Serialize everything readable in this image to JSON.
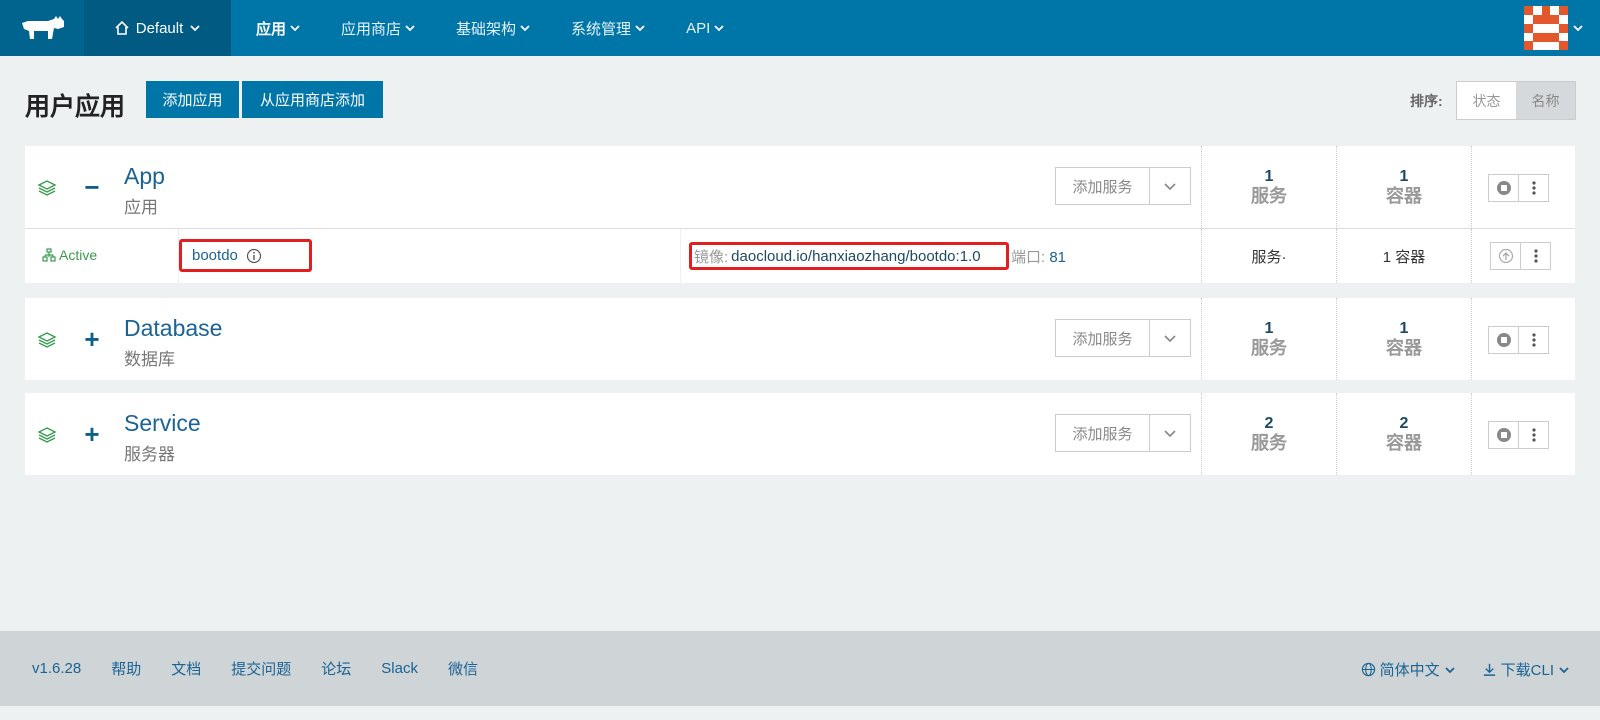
{
  "nav": {
    "environment": "Default",
    "items": [
      {
        "label": "应用",
        "active": true
      },
      {
        "label": "应用商店",
        "active": false
      },
      {
        "label": "基础架构",
        "active": false
      },
      {
        "label": "系统管理",
        "active": false
      },
      {
        "label": "API",
        "active": false
      }
    ]
  },
  "page": {
    "title": "用户应用",
    "add_app_label": "添加应用",
    "add_from_catalog_label": "从应用商店添加",
    "sort_label": "排序:",
    "sort_options": [
      "状态",
      "名称"
    ],
    "sort_selected": "名称"
  },
  "stacks": [
    {
      "name": "App",
      "description": "应用",
      "expanded": true,
      "toggle": "−",
      "add_service_label": "添加服务",
      "service_count": "1",
      "service_label": "服务",
      "container_count": "1",
      "container_label": "容器",
      "services": [
        {
          "state": "Active",
          "name": "bootdo",
          "image_label": "镜像:",
          "image": "daocloud.io/hanxiaozhang/bootdo:1.0",
          "port_label": "端口:",
          "port": "81",
          "service_text": "服务·",
          "container_text": "1 容器"
        }
      ]
    },
    {
      "name": "Database",
      "description": "数据库",
      "expanded": false,
      "toggle": "+",
      "add_service_label": "添加服务",
      "service_count": "1",
      "service_label": "服务",
      "container_count": "1",
      "container_label": "容器"
    },
    {
      "name": "Service",
      "description": "服务器",
      "expanded": false,
      "toggle": "+",
      "add_service_label": "添加服务",
      "service_count": "2",
      "service_label": "服务",
      "container_count": "2",
      "container_label": "容器"
    }
  ],
  "footer": {
    "version": "v1.6.28",
    "links": [
      "帮助",
      "文档",
      "提交问题",
      "论坛",
      "Slack",
      "微信"
    ],
    "language": "简体中文",
    "download": "下载CLI"
  },
  "colors": {
    "nav_bg": "#0075a8",
    "accent": "#0075a8",
    "active_state": "#3a9b4f",
    "highlight_border": "#e02020"
  }
}
